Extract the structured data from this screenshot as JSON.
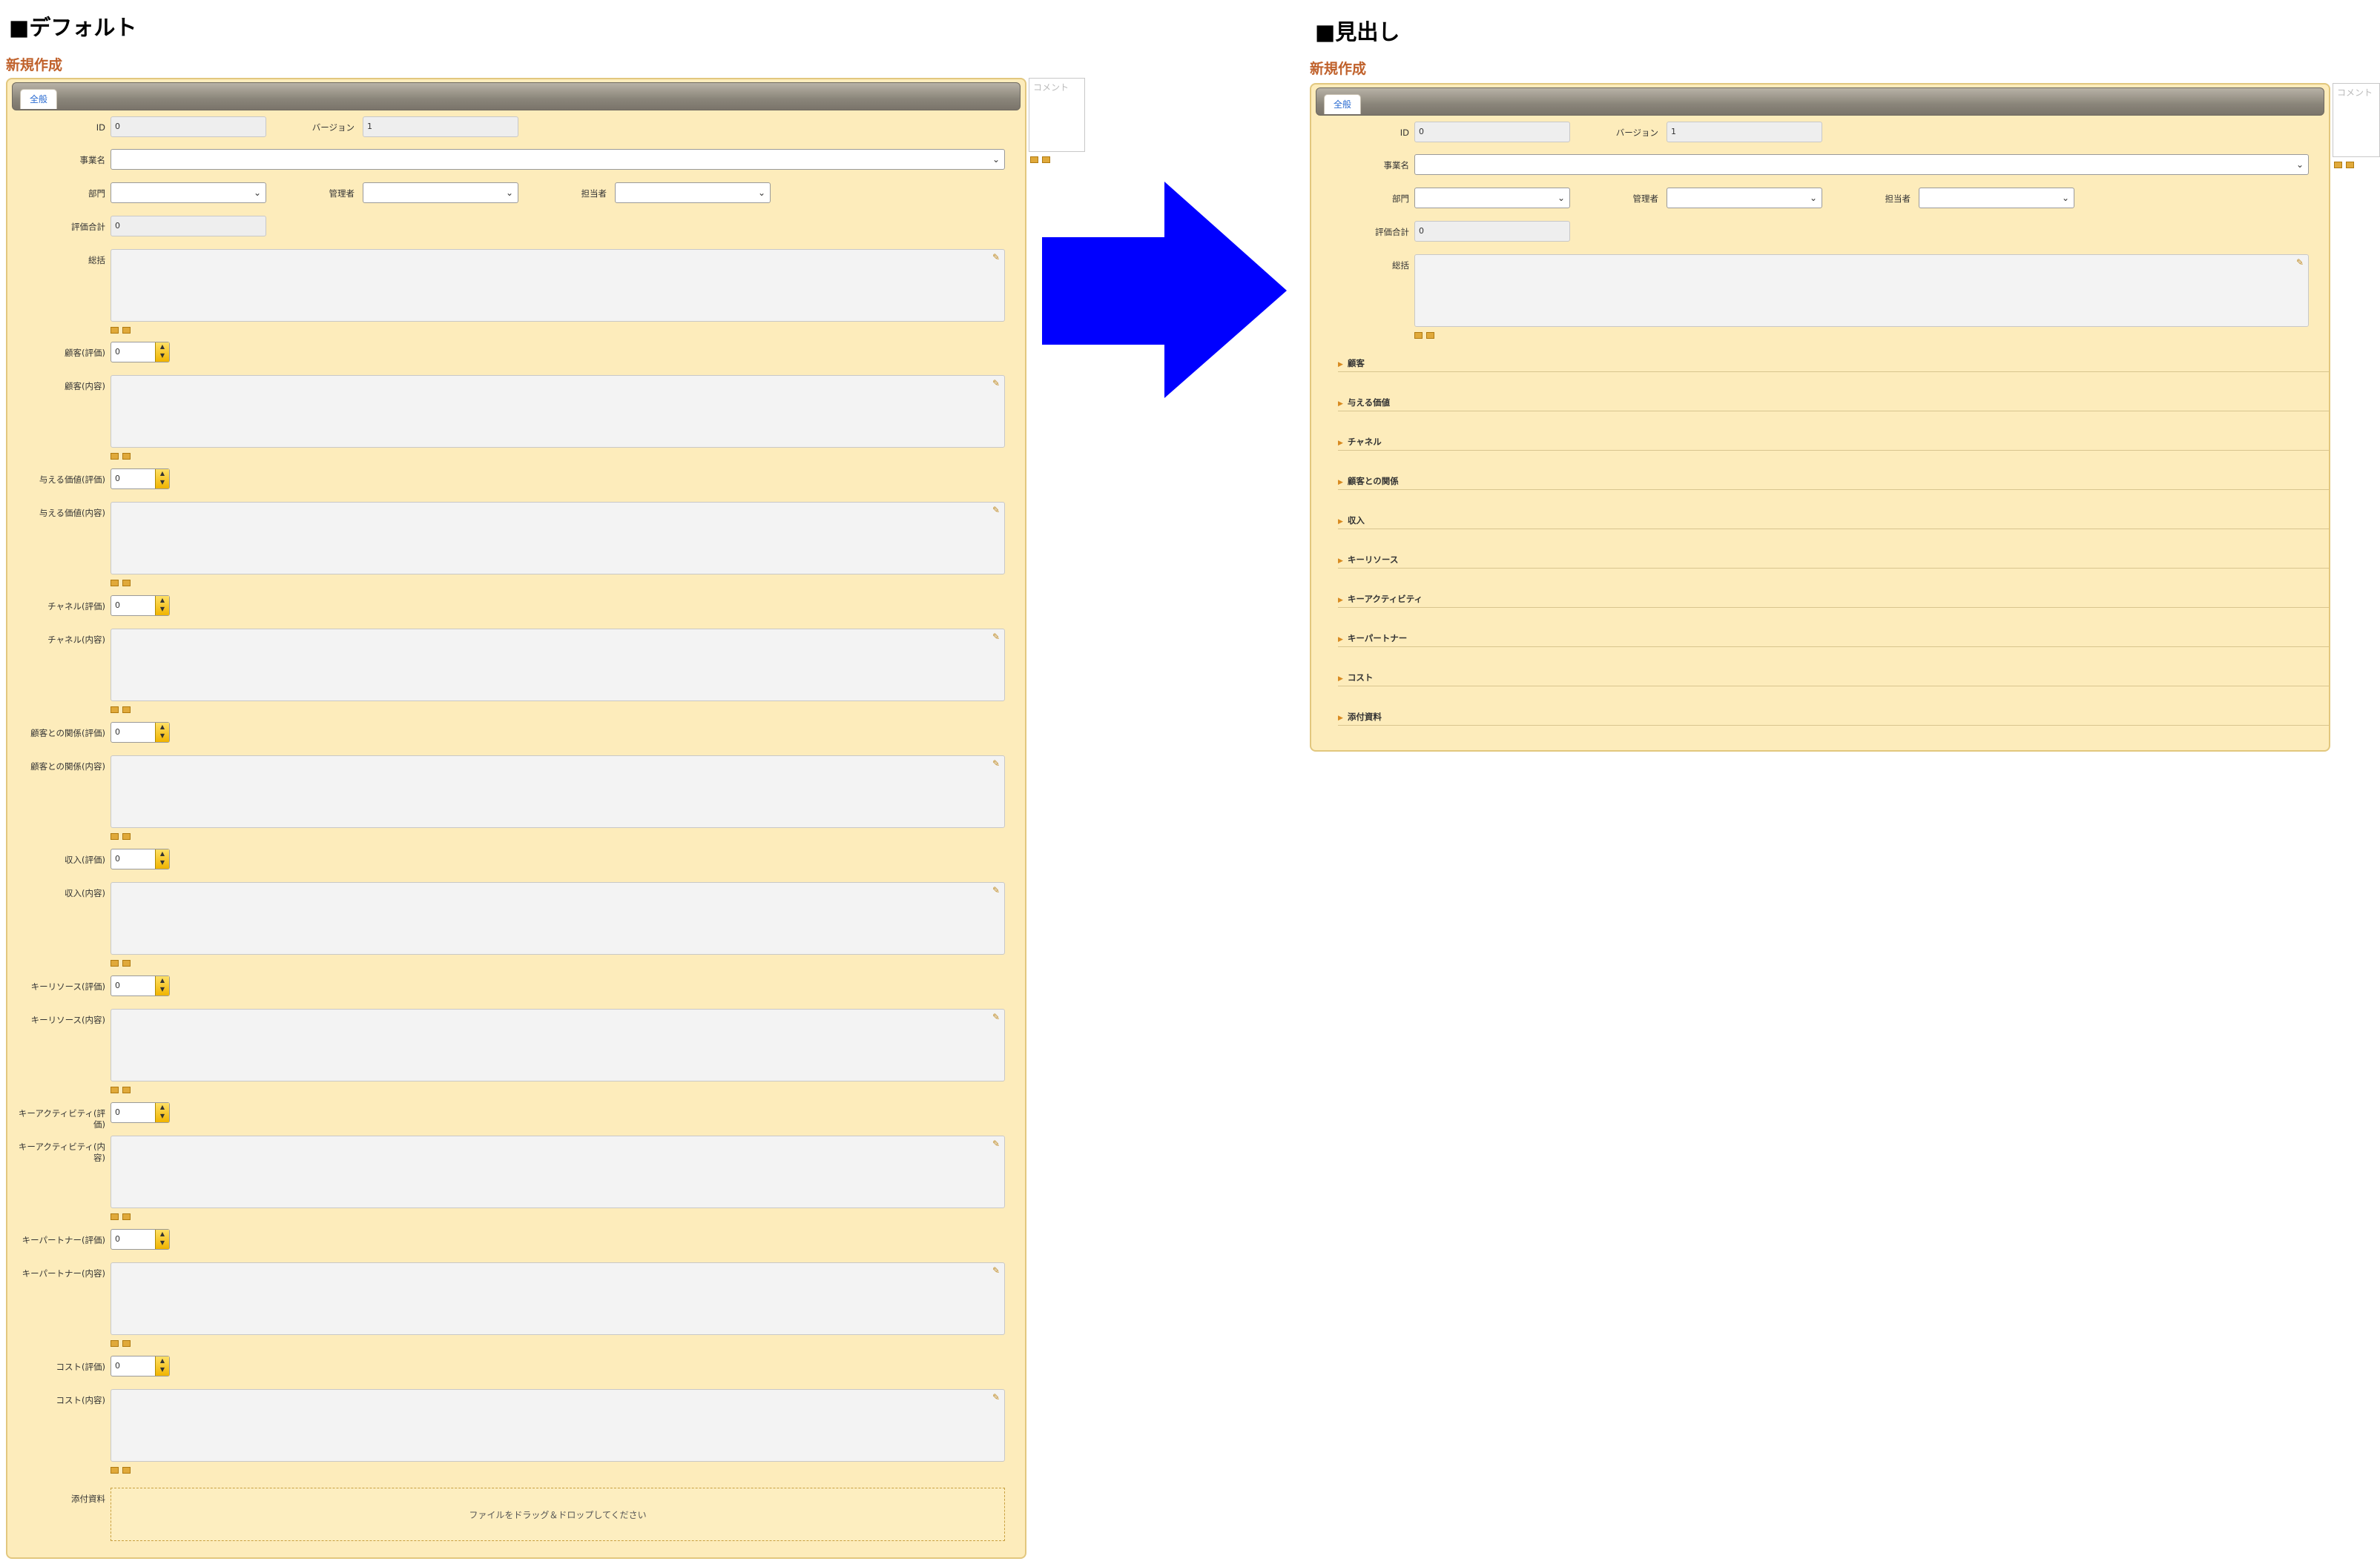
{
  "left": {
    "heading": "■デフォルト",
    "subtitle": "新規作成",
    "tab_label": "全般",
    "comment_placeholder": "コメント",
    "id_label": "ID",
    "id_value": "0",
    "version_label": "バージョン",
    "version_value": "1",
    "business_name_label": "事業名",
    "department_label": "部門",
    "manager_label": "管理者",
    "person_in_charge_label": "担当者",
    "total_score_label": "評価合計",
    "total_score_value": "0",
    "summary_label": "総括",
    "rows": [
      {
        "score_label": "顧客(評価)",
        "score_value": "0",
        "content_label": "顧客(内容)"
      },
      {
        "score_label": "与える価値(評価)",
        "score_value": "0",
        "content_label": "与える価値(内容)"
      },
      {
        "score_label": "チャネル(評価)",
        "score_value": "0",
        "content_label": "チャネル(内容)"
      },
      {
        "score_label": "顧客との関係(評価)",
        "score_value": "0",
        "content_label": "顧客との関係(内容)"
      },
      {
        "score_label": "収入(評価)",
        "score_value": "0",
        "content_label": "収入(内容)"
      },
      {
        "score_label": "キーリソース(評価)",
        "score_value": "0",
        "content_label": "キーリソース(内容)"
      },
      {
        "score_label": "キーアクティビティ(評価)",
        "score_value": "0",
        "content_label": "キーアクティビティ(内容)"
      },
      {
        "score_label": "キーパートナー(評価)",
        "score_value": "0",
        "content_label": "キーパートナー(内容)"
      },
      {
        "score_label": "コスト(評価)",
        "score_value": "0",
        "content_label": "コスト(内容)"
      }
    ],
    "attachments_label": "添付資料",
    "dropzone_text": "ファイルをドラッグ＆ドロップしてください"
  },
  "right": {
    "heading": "■見出し",
    "subtitle": "新規作成",
    "tab_label": "全般",
    "comment_placeholder": "コメント",
    "id_label": "ID",
    "id_value": "0",
    "version_label": "バージョン",
    "version_value": "1",
    "business_name_label": "事業名",
    "department_label": "部門",
    "manager_label": "管理者",
    "person_in_charge_label": "担当者",
    "total_score_label": "評価合計",
    "total_score_value": "0",
    "summary_label": "総括",
    "sections": [
      "顧客",
      "与える価値",
      "チャネル",
      "顧客との関係",
      "収入",
      "キーリソース",
      "キーアクティビティ",
      "キーパートナー",
      "コスト",
      "添付資料"
    ]
  },
  "colors": {
    "arrow": "#0000ff",
    "panel_bg": "#fdecbb",
    "subtitle": "#c0612b"
  }
}
